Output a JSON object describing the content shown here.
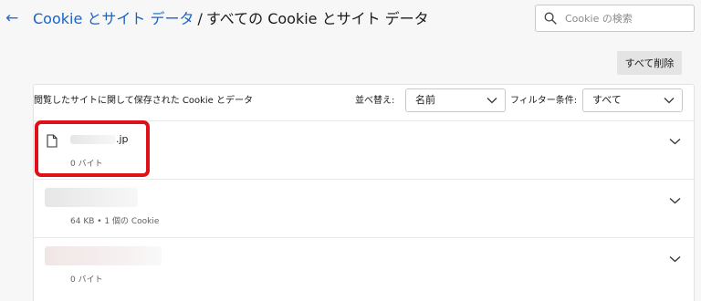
{
  "header": {
    "breadcrumb_parent": "Cookie とサイト データ",
    "breadcrumb_separator": "/",
    "breadcrumb_current": "すべての Cookie とサイト データ"
  },
  "search": {
    "placeholder": "Cookie の検索",
    "value": ""
  },
  "toolbar": {
    "delete_all_label": "すべて削除"
  },
  "panel": {
    "title": "閲覧したサイトに関して保存された Cookie とデータ",
    "sort": {
      "label": "並べ替え:",
      "selected": "名前"
    },
    "filter": {
      "label": "フィルター条件:",
      "selected": "すべて"
    }
  },
  "sites": [
    {
      "domain_suffix": ".jp",
      "size": "0 バイト"
    },
    {
      "domain_suffix": "",
      "size": "64 KB • 1 個の Cookie"
    },
    {
      "domain_suffix": "",
      "size": "0 バイト"
    }
  ],
  "colors": {
    "accent": "#1a63c6",
    "highlight": "#e0101a"
  },
  "icons": {
    "back": "back-arrow-icon",
    "search": "search-icon",
    "file": "file-icon",
    "chevron": "chevron-down-icon"
  }
}
